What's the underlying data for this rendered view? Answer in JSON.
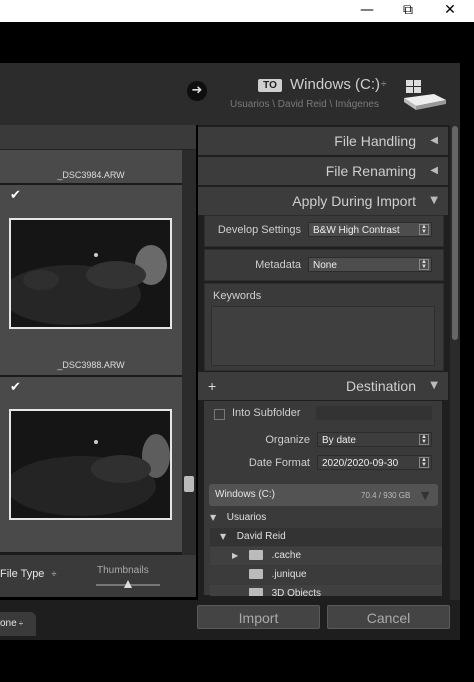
{
  "window": {
    "minimize": "—",
    "maximize": "⧉",
    "close": "✕"
  },
  "header": {
    "arrow": "➜",
    "to_badge": "TO",
    "destination": "Windows (C:)",
    "dest_caret": "÷",
    "path": "Usuarios \\ David Reid \\ Imágenes"
  },
  "grid": {
    "items": [
      {
        "filename": "_DSC3984.ARW",
        "checked": "✔"
      },
      {
        "filename": "_DSC3988.ARW",
        "checked": "✔"
      }
    ]
  },
  "panel": {
    "file_handling": "File Handling",
    "file_renaming": "File Renaming",
    "apply_during_import": "Apply During Import",
    "develop_settings_label": "Develop Settings",
    "develop_settings_value": "B&W High Contrast",
    "metadata_label": "Metadata",
    "metadata_value": "None",
    "keywords_label": "Keywords",
    "destination": "Destination",
    "add_icon": "+",
    "into_subfolder": "Into Subfolder",
    "organize_label": "Organize",
    "organize_value": "By date",
    "date_format_label": "Date Format",
    "date_format_value": "2020/2020-09-30",
    "drive_name": "Windows (C:)",
    "drive_space": "70.4 / 930 GB",
    "tree": [
      {
        "label": "Usuarios"
      },
      {
        "label": "David Reid"
      },
      {
        "label": ".cache"
      },
      {
        "label": ".junique"
      },
      {
        "label": "3D Objects"
      }
    ]
  },
  "toolbar": {
    "file_type": "File Type",
    "thumbnails": "Thumbnails",
    "none": "one"
  },
  "buttons": {
    "import": "Import",
    "cancel": "Cancel"
  }
}
